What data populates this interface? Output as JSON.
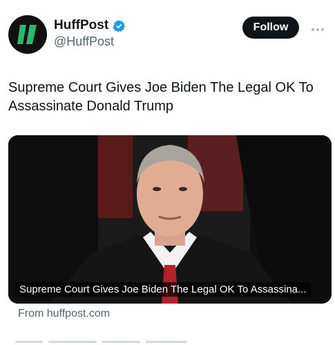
{
  "account": {
    "display_name": "HuffPost",
    "handle": "@HuffPost",
    "verified_icon": "verified-badge-icon",
    "avatar_icon": "huffpost-logo-icon"
  },
  "actions": {
    "follow_label": "Follow",
    "more_icon": "more-options-icon"
  },
  "tweet": {
    "text": "Supreme Court Gives Joe Biden The Legal OK To Assassinate Donald Trump"
  },
  "link_card": {
    "caption": "Supreme Court Gives Joe Biden The Legal OK To Assassina...",
    "source": "From huffpost.com",
    "image_icon": "article-photo"
  },
  "colors": {
    "accent": "#1d9bf0",
    "text": "#0f1419",
    "secondary_text": "#536471",
    "button_bg": "#0f1419"
  }
}
